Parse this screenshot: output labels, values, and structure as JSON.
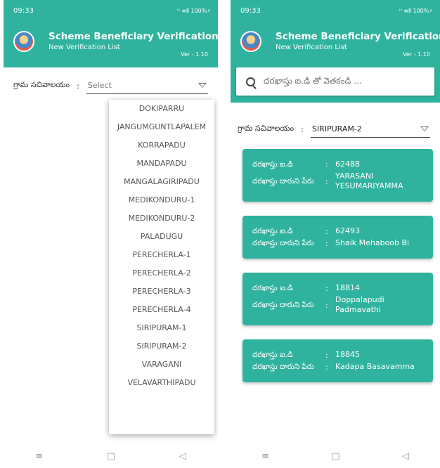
{
  "status": {
    "time": "09:33",
    "signal": "ᴴ ≡Ⅱ 100%⚡"
  },
  "app": {
    "title": "Scheme Beneficiary Verification",
    "subtitle": "New Verification List",
    "version": "Ver - 1.10"
  },
  "filter": {
    "label": "గ్రామ సచివాలయం",
    "colon": ":",
    "placeholder": "Select",
    "selected": "SIRIPURAM-2"
  },
  "dropdown_options": [
    "DOKIPARRU",
    "JANGUMGUNTLAPALEM",
    "KORRAPADU",
    "MANDAPADU",
    "MANGALAGIRIPADU",
    "MEDIKONDURU-1",
    "MEDIKONDURU-2",
    "PALADUGU",
    "PERECHERLA-1",
    "PERECHERLA-2",
    "PERECHERLA-3",
    "PERECHERLA-4",
    "SIRIPURAM-1",
    "SIRIPURAM-2",
    "VARAGANI",
    "VELAVARTHIPADU"
  ],
  "search": {
    "placeholder": "దరఖాస్తు ఐ.డి తో వెతకండి ..."
  },
  "card_labels": {
    "id": "దరఖాస్తు ఐ.డి",
    "name": "దరఖాస్తు దారుని పేరు"
  },
  "cards": [
    {
      "id": "62488",
      "name": "YARASANI YESUMARIYAMMA"
    },
    {
      "id": "62493",
      "name": "Shaik Mehaboob Bi"
    },
    {
      "id": "18814",
      "name": "Doppalapudi Padmavathi"
    },
    {
      "id": "18845",
      "name": "Kadapa Basavamma"
    }
  ],
  "nav": {
    "menu": "≡",
    "home": "□",
    "back": "◁"
  },
  "colors": {
    "primary": "#2fb39e"
  }
}
